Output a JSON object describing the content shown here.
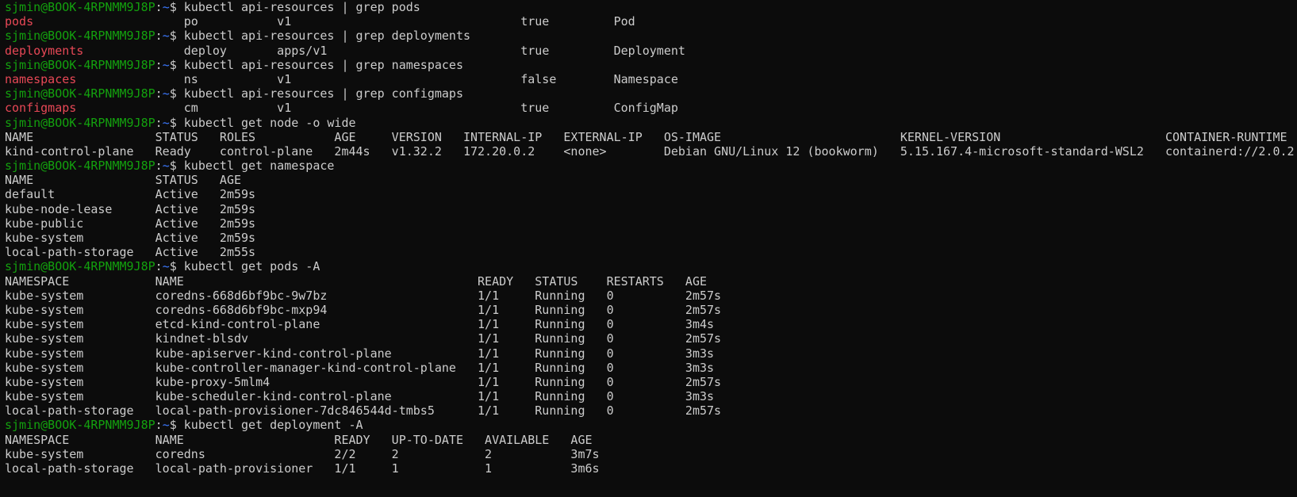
{
  "terminal": {
    "prompt_user": "sjmin@BOOK-4RPNMM9J8P",
    "prompt_sep": ":",
    "prompt_path": "~",
    "prompt_symbol": "$ ",
    "colors": {
      "background": "#0c0c0c",
      "prompt_user": "#13a10e",
      "prompt_path": "#3b78ff",
      "grep_match": "#e74856",
      "text": "#cccccc"
    },
    "lines": [
      {
        "type": "cmd",
        "text": "kubectl api-resources | grep pods"
      },
      {
        "type": "match",
        "match": "pods",
        "rest": "                     po           v1                                true         Pod"
      },
      {
        "type": "cmd",
        "text": "kubectl api-resources | grep deployments"
      },
      {
        "type": "match",
        "match": "deployments",
        "rest": "              deploy       apps/v1                           true         Deployment"
      },
      {
        "type": "cmd",
        "text": "kubectl api-resources | grep namespaces"
      },
      {
        "type": "match",
        "match": "namespaces",
        "rest": "               ns           v1                                false        Namespace"
      },
      {
        "type": "cmd",
        "text": "kubectl api-resources | grep configmaps"
      },
      {
        "type": "match",
        "match": "configmaps",
        "rest": "               cm           v1                                true         ConfigMap"
      },
      {
        "type": "cmd",
        "text": "kubectl get node -o wide"
      },
      {
        "type": "out",
        "text": "NAME                 STATUS   ROLES           AGE     VERSION   INTERNAL-IP   EXTERNAL-IP   OS-IMAGE                         KERNEL-VERSION                       CONTAINER-RUNTIME"
      },
      {
        "type": "out",
        "text": "kind-control-plane   Ready    control-plane   2m44s   v1.32.2   172.20.0.2    <none>        Debian GNU/Linux 12 (bookworm)   5.15.167.4-microsoft-standard-WSL2   containerd://2.0.2"
      },
      {
        "type": "cmd",
        "text": "kubectl get namespace"
      },
      {
        "type": "out",
        "text": "NAME                 STATUS   AGE"
      },
      {
        "type": "out",
        "text": "default              Active   2m59s"
      },
      {
        "type": "out",
        "text": "kube-node-lease      Active   2m59s"
      },
      {
        "type": "out",
        "text": "kube-public          Active   2m59s"
      },
      {
        "type": "out",
        "text": "kube-system          Active   2m59s"
      },
      {
        "type": "out",
        "text": "local-path-storage   Active   2m55s"
      },
      {
        "type": "cmd",
        "text": "kubectl get pods -A"
      },
      {
        "type": "out",
        "text": "NAMESPACE            NAME                                         READY   STATUS    RESTARTS   AGE"
      },
      {
        "type": "out",
        "text": "kube-system          coredns-668d6bf9bc-9w7bz                     1/1     Running   0          2m57s"
      },
      {
        "type": "out",
        "text": "kube-system          coredns-668d6bf9bc-mxp94                     1/1     Running   0          2m57s"
      },
      {
        "type": "out",
        "text": "kube-system          etcd-kind-control-plane                      1/1     Running   0          3m4s"
      },
      {
        "type": "out",
        "text": "kube-system          kindnet-blsdv                                1/1     Running   0          2m57s"
      },
      {
        "type": "out",
        "text": "kube-system          kube-apiserver-kind-control-plane            1/1     Running   0          3m3s"
      },
      {
        "type": "out",
        "text": "kube-system          kube-controller-manager-kind-control-plane   1/1     Running   0          3m3s"
      },
      {
        "type": "out",
        "text": "kube-system          kube-proxy-5mlm4                             1/1     Running   0          2m57s"
      },
      {
        "type": "out",
        "text": "kube-system          kube-scheduler-kind-control-plane            1/1     Running   0          3m3s"
      },
      {
        "type": "out",
        "text": "local-path-storage   local-path-provisioner-7dc846544d-tmbs5      1/1     Running   0          2m57s"
      },
      {
        "type": "cmd",
        "text": "kubectl get deployment -A"
      },
      {
        "type": "out",
        "text": "NAMESPACE            NAME                     READY   UP-TO-DATE   AVAILABLE   AGE"
      },
      {
        "type": "out",
        "text": "kube-system          coredns                  2/2     2            2           3m7s"
      },
      {
        "type": "out",
        "text": "local-path-storage   local-path-provisioner   1/1     1            1           3m6s"
      }
    ]
  }
}
